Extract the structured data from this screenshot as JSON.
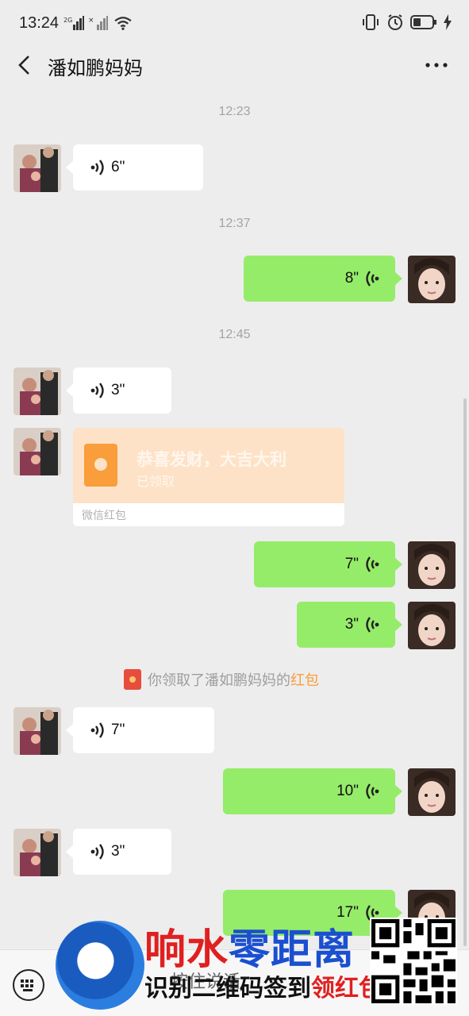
{
  "status_bar": {
    "time": "13:24",
    "network_label": "2G"
  },
  "header": {
    "title": "潘如鹏妈妈"
  },
  "timestamps": [
    "12:23",
    "12:37",
    "12:45"
  ],
  "messages": [
    {
      "side": "left",
      "duration": "6\""
    },
    {
      "side": "right",
      "duration": "8\""
    },
    {
      "side": "left",
      "duration": "3\""
    },
    {
      "side": "right",
      "duration": "7\""
    },
    {
      "side": "right",
      "duration": "3\""
    },
    {
      "side": "left",
      "duration": "7\""
    },
    {
      "side": "right",
      "duration": "10\""
    },
    {
      "side": "left",
      "duration": "3\""
    },
    {
      "side": "right",
      "duration": "17\""
    }
  ],
  "red_packet": {
    "title": "恭喜发财，大吉大利",
    "status": "已领取",
    "footer": "微信红包"
  },
  "system_message": {
    "text": "你领取了潘如鹏妈妈的",
    "link": "红包"
  },
  "input": {
    "partial_text": "按住说话"
  },
  "watermark": {
    "line1_a": "响水",
    "line1_b": "零距离",
    "line2_a": "识别二维码签到",
    "line2_b": "领红包"
  },
  "colors": {
    "self_bubble": "#95ec69",
    "other_bubble": "#ffffff",
    "background": "#ededed",
    "red_packet": "#fde2c7"
  }
}
